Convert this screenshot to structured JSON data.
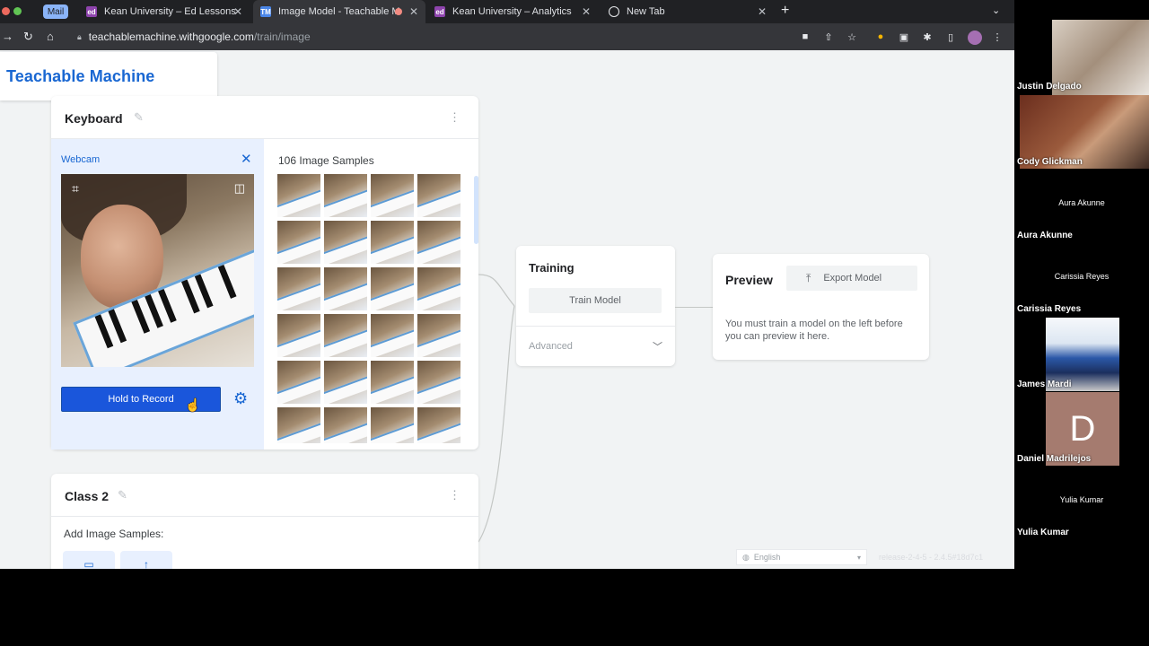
{
  "browser": {
    "tabs": [
      {
        "label": "Mail"
      },
      {
        "label": "Kean University – Ed Lessons"
      },
      {
        "label": "Image Model - Teachable M"
      },
      {
        "label": "Kean University – Analytics"
      },
      {
        "label": "New Tab"
      }
    ],
    "url_host": "teachablemachine.withgoogle.com",
    "url_path": "/train/image"
  },
  "app": {
    "brand": "Teachable Machine",
    "class1": {
      "title": "Keyboard",
      "webcam_label": "Webcam",
      "record_button": "Hold to Record",
      "samples_title": "106 Image Samples",
      "thumb_count": 24
    },
    "class2": {
      "title": "Class 2",
      "add_samples": "Add Image Samples:"
    },
    "training": {
      "title": "Training",
      "train_button": "Train Model",
      "advanced": "Advanced"
    },
    "preview": {
      "title": "Preview",
      "export_button": "Export Model",
      "message": "You must train a model on the left before you can preview it here."
    },
    "language": "English",
    "version": "release-2-4-5 - 2.4.5#18d7c1"
  },
  "participants": [
    {
      "name": "Justin Delgado",
      "center": ""
    },
    {
      "name": "Cody Glickman",
      "center": ""
    },
    {
      "name": "Aura Akunne",
      "center": "Aura Akunne"
    },
    {
      "name": "Carissia Reyes",
      "center": "Carissia Reyes"
    },
    {
      "name": "James Mardi",
      "center": ""
    },
    {
      "name": "Daniel Madrilejos",
      "center": "",
      "initial": "D"
    },
    {
      "name": "Yulia Kumar",
      "center": "Yulia Kumar"
    }
  ],
  "colors": {
    "accent": "#1a56db",
    "brand_blue": "#1967d2",
    "page_bg": "#f1f3f4",
    "chrome_dark": "#202124"
  }
}
